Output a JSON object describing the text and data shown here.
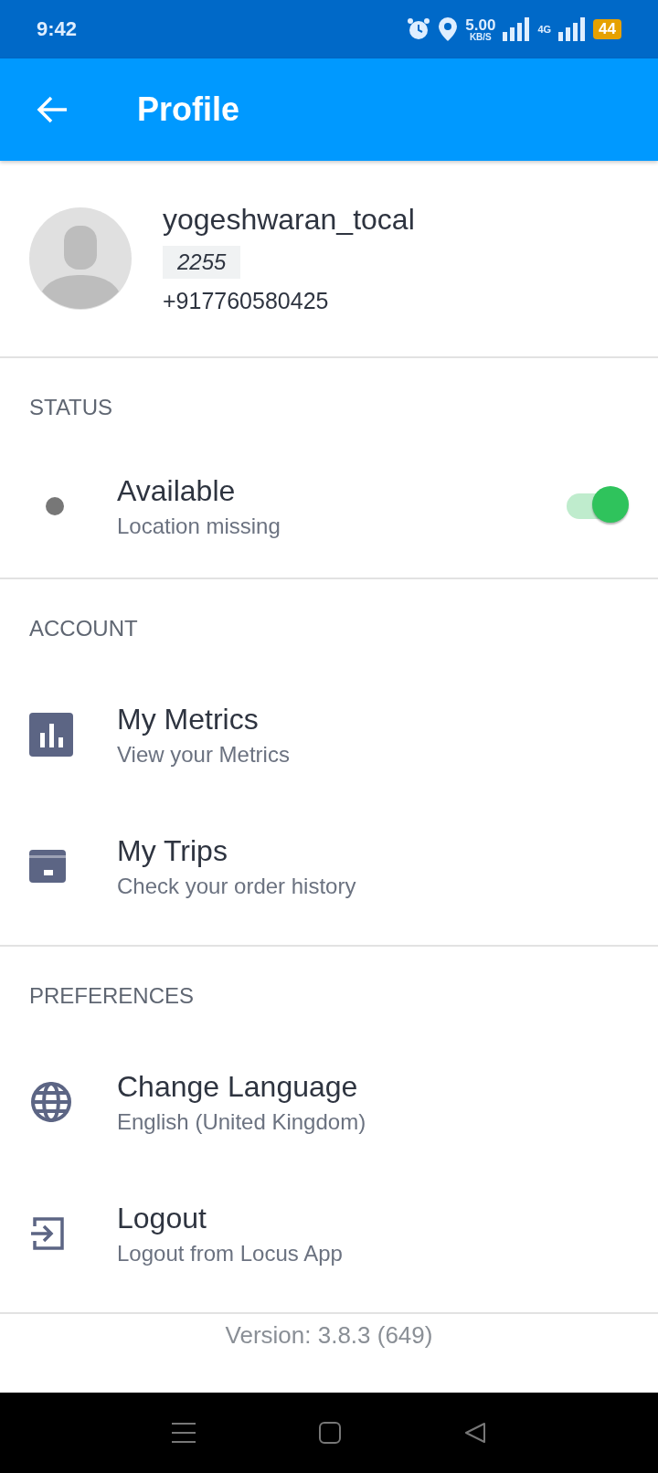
{
  "status_bar": {
    "time": "9:42",
    "speed_value": "5.00",
    "speed_unit": "KB/S",
    "network": "4G",
    "battery": "44"
  },
  "app_bar": {
    "title": "Profile"
  },
  "profile": {
    "username": "yogeshwaran_tocal",
    "code": "2255",
    "phone": "+917760580425"
  },
  "sections": [
    {
      "title": "STATUS",
      "items": [
        {
          "kind": "toggle",
          "title": "Available",
          "subtitle": "Location missing",
          "on": true
        }
      ]
    },
    {
      "title": "ACCOUNT",
      "items": [
        {
          "kind": "metrics",
          "title": "My Metrics",
          "subtitle": "View your Metrics"
        },
        {
          "kind": "trips",
          "title": "My Trips",
          "subtitle": "Check your order history"
        }
      ]
    },
    {
      "title": "PREFERENCES",
      "items": [
        {
          "kind": "language",
          "title": "Change Language",
          "subtitle": "English (United Kingdom)"
        },
        {
          "kind": "logout",
          "title": "Logout",
          "subtitle": "Logout from Locus App"
        }
      ]
    }
  ],
  "version": "Version: 3.8.3 (649)"
}
